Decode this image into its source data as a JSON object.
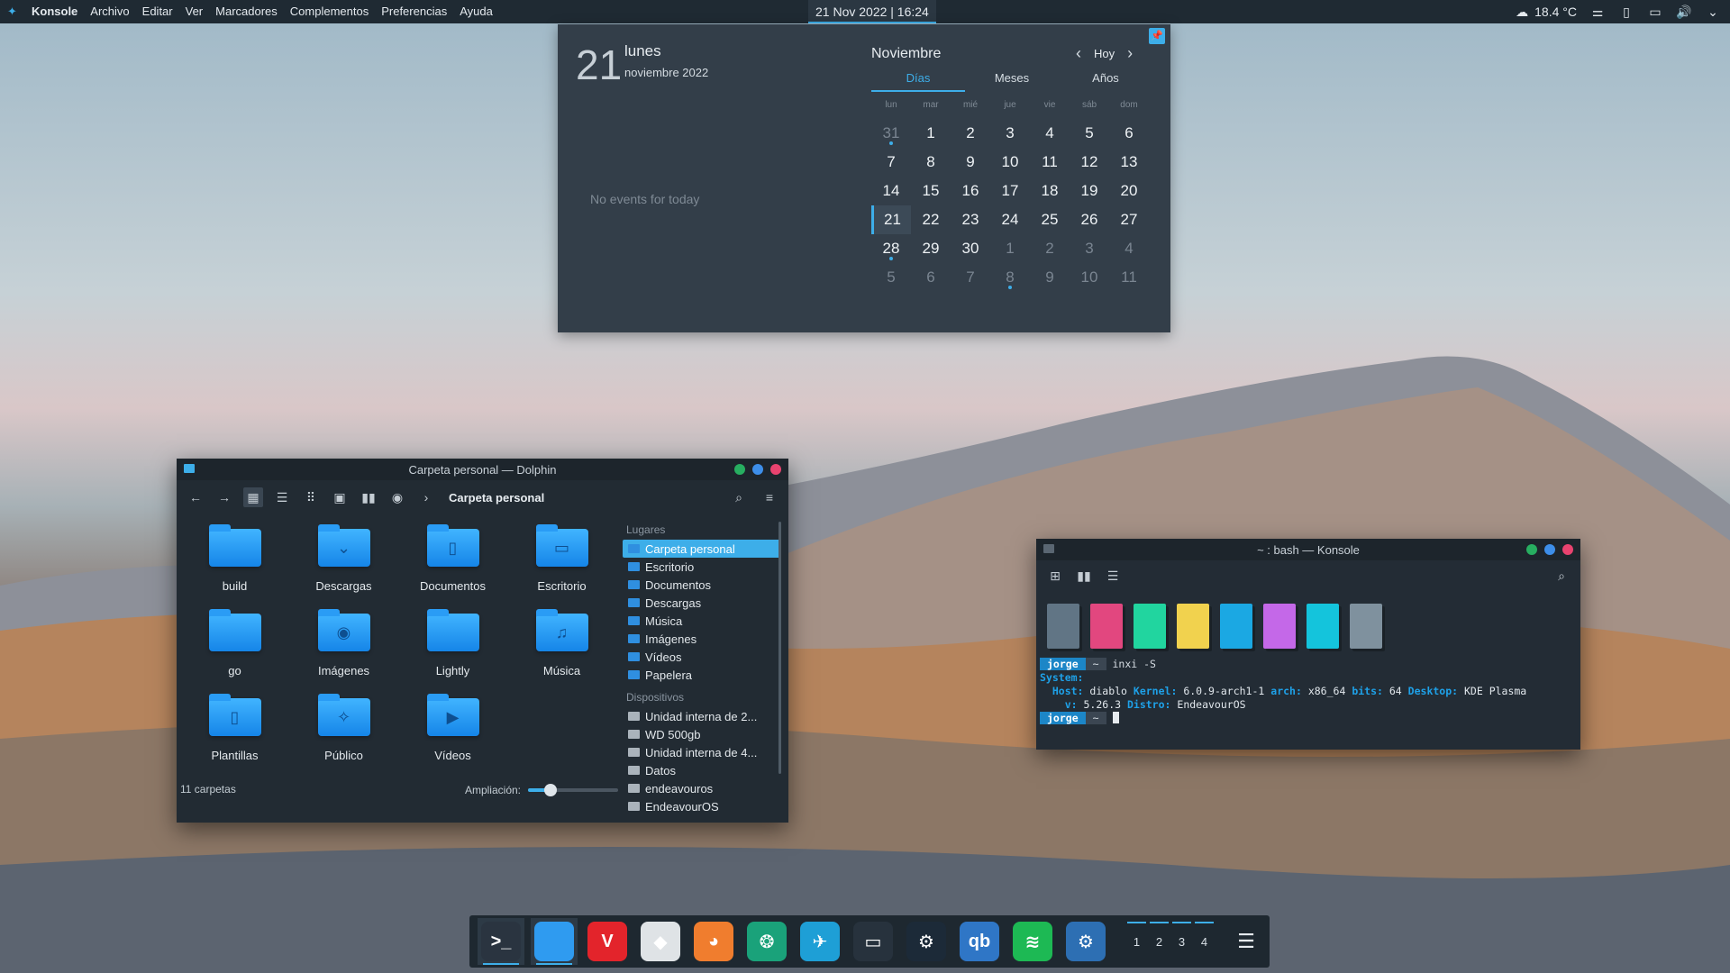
{
  "top_panel": {
    "app_name": "Konsole",
    "menu": [
      "Archivo",
      "Editar",
      "Ver",
      "Marcadores",
      "Complementos",
      "Preferencias",
      "Ayuda"
    ],
    "clock": "21 Nov 2022 | 16:24",
    "weather": "18.4 °C"
  },
  "calendar": {
    "big_day": "21",
    "weekday": "lunes",
    "month_year": "noviembre 2022",
    "no_events": "No events for today",
    "month": "Noviembre",
    "today_button": "Hoy",
    "tabs": [
      "Días",
      "Meses",
      "Años"
    ],
    "weekdays": [
      "lun",
      "mar",
      "mié",
      "jue",
      "vie",
      "sáb",
      "dom"
    ],
    "days": [
      {
        "n": "31",
        "muted": true,
        "dot": true
      },
      {
        "n": "1"
      },
      {
        "n": "2"
      },
      {
        "n": "3"
      },
      {
        "n": "4"
      },
      {
        "n": "5"
      },
      {
        "n": "6"
      },
      {
        "n": "7"
      },
      {
        "n": "8"
      },
      {
        "n": "9"
      },
      {
        "n": "10"
      },
      {
        "n": "11"
      },
      {
        "n": "12"
      },
      {
        "n": "13"
      },
      {
        "n": "14"
      },
      {
        "n": "15"
      },
      {
        "n": "16"
      },
      {
        "n": "17"
      },
      {
        "n": "18"
      },
      {
        "n": "19"
      },
      {
        "n": "20"
      },
      {
        "n": "21",
        "today": true
      },
      {
        "n": "22"
      },
      {
        "n": "23"
      },
      {
        "n": "24"
      },
      {
        "n": "25"
      },
      {
        "n": "26"
      },
      {
        "n": "27"
      },
      {
        "n": "28",
        "dot": true
      },
      {
        "n": "29"
      },
      {
        "n": "30"
      },
      {
        "n": "1",
        "muted": true
      },
      {
        "n": "2",
        "muted": true
      },
      {
        "n": "3",
        "muted": true
      },
      {
        "n": "4",
        "muted": true
      },
      {
        "n": "5",
        "muted": true
      },
      {
        "n": "6",
        "muted": true
      },
      {
        "n": "7",
        "muted": true
      },
      {
        "n": "8",
        "muted": true,
        "dot": true
      },
      {
        "n": "9",
        "muted": true
      },
      {
        "n": "10",
        "muted": true
      },
      {
        "n": "11",
        "muted": true
      }
    ]
  },
  "dolphin": {
    "title": "Carpeta personal — Dolphin",
    "breadcrumb": "Carpeta personal",
    "files": [
      {
        "label": "build",
        "glyph": ""
      },
      {
        "label": "Descargas",
        "glyph": "⌄"
      },
      {
        "label": "Documentos",
        "glyph": "▯"
      },
      {
        "label": "Escritorio",
        "glyph": "▭"
      },
      {
        "label": "go",
        "glyph": ""
      },
      {
        "label": "Imágenes",
        "glyph": "◉"
      },
      {
        "label": "Lightly",
        "glyph": ""
      },
      {
        "label": "Música",
        "glyph": "♫"
      },
      {
        "label": "Plantillas",
        "glyph": "▯"
      },
      {
        "label": "Público",
        "glyph": "✧"
      },
      {
        "label": "Vídeos",
        "glyph": "▶"
      }
    ],
    "status": "11 carpetas",
    "zoom_label": "Ampliación:",
    "zoom_level": 0.25,
    "places_header": "Lugares",
    "places": [
      "Carpeta personal",
      "Escritorio",
      "Documentos",
      "Descargas",
      "Música",
      "Imágenes",
      "Vídeos",
      "Papelera"
    ],
    "devices_header": "Dispositivos",
    "devices": [
      "Unidad interna de 2...",
      "WD 500gb",
      "Unidad interna de 4...",
      "Datos",
      "endeavouros",
      "EndeavourOS"
    ]
  },
  "konsole": {
    "title": "~ : bash — Konsole",
    "swatch_colors": [
      "#617585",
      "#e2477f",
      "#21d59f",
      "#f1d24e",
      "#1ba8e3",
      "#c468e8",
      "#14c4dc",
      "#7f919e"
    ],
    "prompt_user": "jorge",
    "prompt_dir": "~",
    "command": "inxi -S",
    "line_system": "System:",
    "host_key": "Host:",
    "host_val": "diablo",
    "kernel_key": "Kernel:",
    "kernel_val": "6.0.9-arch1-1",
    "arch_key": "arch:",
    "arch_val": "x86_64",
    "bits_key": "bits:",
    "bits_val": "64",
    "desktop_key": "Desktop:",
    "desktop_val": "KDE Plasma",
    "v_key": "v:",
    "v_val": "5.26.3",
    "distro_key": "Distro:",
    "distro_val": "EndeavourOS"
  },
  "dock": {
    "apps": [
      {
        "name": "konsole-app",
        "glyph": ">_",
        "color": "#2a3440"
      },
      {
        "name": "dolphin-app",
        "glyph": "",
        "color": "#2f9bf0"
      },
      {
        "name": "vivaldi-app",
        "glyph": "V",
        "color": "#e3242b"
      },
      {
        "name": "inkscape-app",
        "glyph": "◆",
        "color": "#dfe3e6"
      },
      {
        "name": "gimp-app",
        "glyph": "◕",
        "color": "#f07d2e"
      },
      {
        "name": "gitkraken-app",
        "glyph": "❂",
        "color": "#1aa27a"
      },
      {
        "name": "kdeconnect-app",
        "glyph": "✈",
        "color": "#1e9fd6"
      },
      {
        "name": "remote-app",
        "glyph": "▭",
        "color": "#27323d"
      },
      {
        "name": "steam-app",
        "glyph": "⚙",
        "color": "#1c2a38"
      },
      {
        "name": "qbittorrent-app",
        "glyph": "qb",
        "color": "#2f76c6"
      },
      {
        "name": "spotify-app",
        "glyph": "≋",
        "color": "#1db954"
      },
      {
        "name": "settings-app",
        "glyph": "⚙",
        "color": "#2d6fb3"
      }
    ],
    "pager": [
      "1",
      "2",
      "3",
      "4"
    ],
    "menu_glyph": "☰"
  }
}
